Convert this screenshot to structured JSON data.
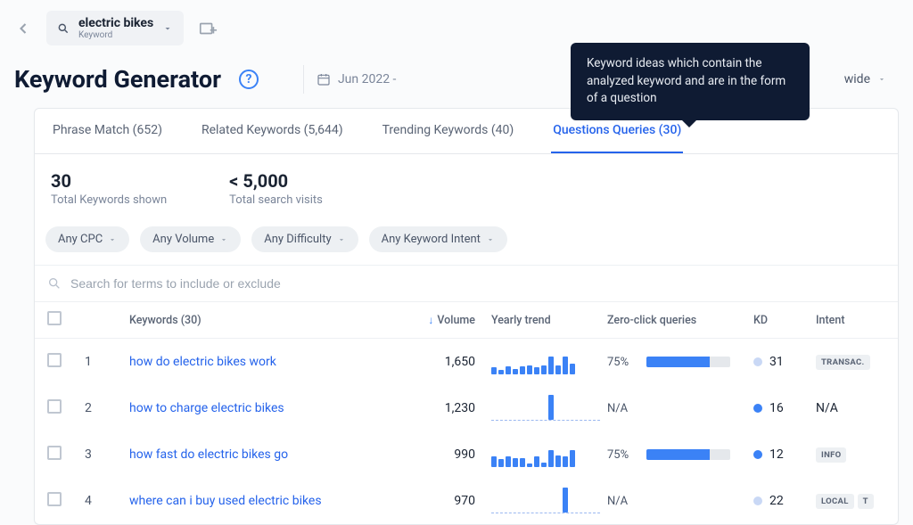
{
  "topbar": {
    "keyword_value": "electric bikes",
    "keyword_type": "Keyword"
  },
  "header": {
    "title": "Keyword Generator",
    "date_range": "Jun 2022 -",
    "country": "wide"
  },
  "tooltip": {
    "text": "Keyword ideas which contain the analyzed keyword and are in the form of a question"
  },
  "tabs": [
    {
      "label": "Phrase Match (652)",
      "active": false
    },
    {
      "label": "Related Keywords (5,644)",
      "active": false
    },
    {
      "label": "Trending Keywords (40)",
      "active": false
    },
    {
      "label": "Questions Queries (30)",
      "active": true
    }
  ],
  "stats": {
    "total_keywords_value": "30",
    "total_keywords_label": "Total Keywords shown",
    "total_visits_value": "< 5,000",
    "total_visits_label": "Total search visits"
  },
  "filters": [
    {
      "label": "Any CPC"
    },
    {
      "label": "Any Volume"
    },
    {
      "label": "Any Difficulty"
    },
    {
      "label": "Any Keyword Intent"
    }
  ],
  "table_search_placeholder": "Search for terms to include or exclude",
  "columns": {
    "keywords": "Keywords (30)",
    "volume": "Volume",
    "trend": "Yearly trend",
    "zcq": "Zero-click queries",
    "kd": "KD",
    "intent": "Intent"
  },
  "rows": [
    {
      "idx": "1",
      "keyword": "how do electric bikes work",
      "volume": "1,650",
      "trend": [
        8,
        5,
        9,
        6,
        9,
        10,
        8,
        10,
        20,
        10,
        20,
        12
      ],
      "zcq_pct": "75%",
      "zcq_fill": 75,
      "kd_dot": "easy",
      "kd": "31",
      "intent": "TRANSAC."
    },
    {
      "idx": "2",
      "keyword": "how to charge electric bikes",
      "volume": "1,230",
      "trend_dashed": true,
      "trend": [
        0,
        0,
        0,
        0,
        0,
        0,
        0,
        0,
        28,
        0,
        0,
        0
      ],
      "zcq_pct": "N/A",
      "zcq_fill": null,
      "kd_dot": "med",
      "kd": "16",
      "intent": "N/A"
    },
    {
      "idx": "3",
      "keyword": "how fast do electric bikes go",
      "volume": "990",
      "trend": [
        12,
        9,
        12,
        10,
        10,
        4,
        12,
        5,
        19,
        13,
        12,
        19
      ],
      "zcq_pct": "75%",
      "zcq_fill": 75,
      "kd_dot": "med",
      "kd": "12",
      "intent": "INFO"
    },
    {
      "idx": "4",
      "keyword": "where can i buy used electric bikes",
      "volume": "970",
      "trend_dashed": true,
      "trend": [
        0,
        0,
        0,
        0,
        0,
        0,
        0,
        0,
        0,
        0,
        28,
        0
      ],
      "zcq_pct": "N/A",
      "zcq_fill": null,
      "kd_dot": "easy",
      "kd": "22",
      "intent": "LOCAL"
    }
  ],
  "chart_data": {
    "type": "table",
    "title": "Questions Queries for 'electric bikes'",
    "columns": [
      "#",
      "Keyword",
      "Volume",
      "Zero-click %",
      "KD",
      "Intent"
    ],
    "rows": [
      [
        1,
        "how do electric bikes work",
        1650,
        75,
        31,
        "TRANSAC."
      ],
      [
        2,
        "how to charge electric bikes",
        1230,
        null,
        16,
        "N/A"
      ],
      [
        3,
        "how fast do electric bikes go",
        990,
        75,
        12,
        "INFO"
      ],
      [
        4,
        "where can i buy used electric bikes",
        970,
        null,
        22,
        "LOCAL"
      ]
    ]
  }
}
